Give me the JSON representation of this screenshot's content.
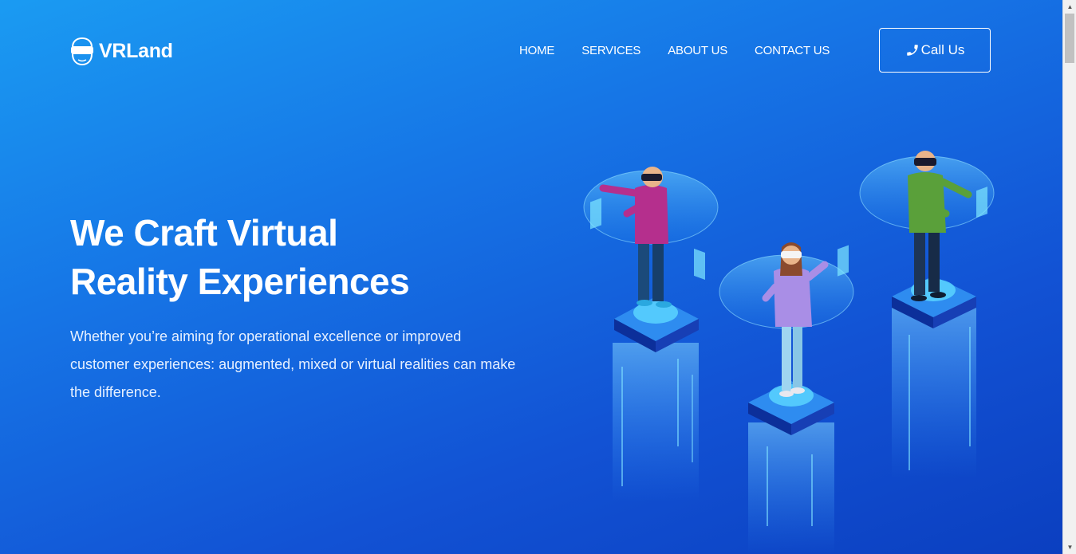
{
  "brand": {
    "name": "VRLand",
    "logo_icon": "vr-headset-icon"
  },
  "nav": {
    "items": [
      {
        "label": "HOME"
      },
      {
        "label": "SERVICES"
      },
      {
        "label": "ABOUT US"
      },
      {
        "label": "CONTACT US"
      }
    ]
  },
  "cta": {
    "label": "Call Us",
    "icon": "phone-icon"
  },
  "hero": {
    "title_line1": "We Craft Virtual",
    "title_line2": "Reality Experiences",
    "description": "Whether you’re aiming for operational excellence or improved customer experiences: augmented, mixed or virtual realities can make the difference."
  },
  "colors": {
    "gradient_start": "#1a9bf2",
    "gradient_end": "#0b3fc0",
    "text": "#ffffff"
  }
}
